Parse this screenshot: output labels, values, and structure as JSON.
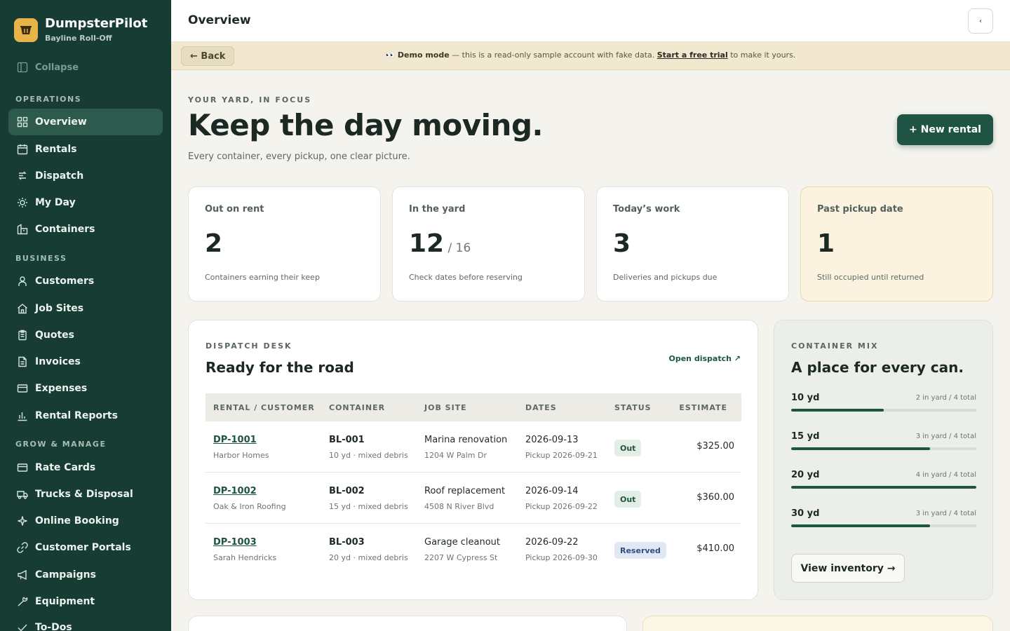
{
  "brand": {
    "name": "DumpsterPilot",
    "sub": "Bayline Roll-Off",
    "collapse": "Collapse"
  },
  "sidebar": {
    "sections": [
      "OPERATIONS",
      "BUSINESS",
      "GROW & MANAGE"
    ],
    "operations": [
      "Overview",
      "Rentals",
      "Dispatch",
      "My Day",
      "Containers"
    ],
    "business": [
      "Customers",
      "Job Sites",
      "Quotes",
      "Invoices",
      "Expenses",
      "Rental Reports"
    ],
    "grow": [
      "Rate Cards",
      "Trucks & Disposal",
      "Online Booking",
      "Customer Portals",
      "Campaigns",
      "Equipment",
      "To-Dos"
    ]
  },
  "topbar": {
    "title": "Overview",
    "toggle_icon": "chevron-left-icon"
  },
  "banner": {
    "back": "← Back",
    "emoji": "👀",
    "label": "Demo mode",
    "text": " — this is a read-only sample account with fake data. ",
    "link": "Start a free trial",
    "suffix": " to make it yours."
  },
  "hero": {
    "eyebrow": "YOUR YARD, IN FOCUS",
    "title": "Keep the day moving.",
    "subtitle": "Every container, every pickup, one clear picture.",
    "new_rental": "+  New rental"
  },
  "stats": [
    {
      "label": "Out on rent",
      "value": "2",
      "of": "",
      "note": "Containers earning their keep"
    },
    {
      "label": "In the yard",
      "value": "12",
      "of": " / 16",
      "note": "Check dates before reserving"
    },
    {
      "label": "Today’s work",
      "value": "3",
      "of": "",
      "note": "Deliveries and pickups due"
    },
    {
      "label": "Past pickup date",
      "value": "1",
      "of": "",
      "note": "Still occupied until returned"
    }
  ],
  "dispatch": {
    "eyebrow": "DISPATCH DESK",
    "title": "Ready for the road",
    "open_link": "Open dispatch ↗",
    "columns": [
      "RENTAL / CUSTOMER",
      "CONTAINER",
      "JOB SITE",
      "DATES",
      "STATUS",
      "ESTIMATE"
    ],
    "rows": [
      {
        "id": "DP-1001",
        "customer": "Harbor Homes",
        "container": "BL-001",
        "container_sub": "10 yd · mixed debris",
        "site": "Marina renovation",
        "address": "1204 W Palm Dr",
        "date": "2026-09-13",
        "pickup": "Pickup 2026-09-21",
        "status": "Out",
        "estimate": "$325.00"
      },
      {
        "id": "DP-1002",
        "customer": "Oak & Iron Roofing",
        "container": "BL-002",
        "container_sub": "15 yd · mixed debris",
        "site": "Roof replacement",
        "address": "4508 N River Blvd",
        "date": "2026-09-14",
        "pickup": "Pickup 2026-09-22",
        "status": "Out",
        "estimate": "$360.00"
      },
      {
        "id": "DP-1003",
        "customer": "Sarah Hendricks",
        "container": "BL-003",
        "container_sub": "20 yd · mixed debris",
        "site": "Garage cleanout",
        "address": "2207 W Cypress St",
        "date": "2026-09-22",
        "pickup": "Pickup 2026-09-30",
        "status": "Reserved",
        "estimate": "$410.00"
      }
    ]
  },
  "mix": {
    "eyebrow": "CONTAINER MIX",
    "title": "A place for every can.",
    "rows": [
      {
        "size": "10 yd",
        "count": "2 in yard / 4 total",
        "fraction": 0.5
      },
      {
        "size": "15 yd",
        "count": "3 in yard / 4 total",
        "fraction": 0.75
      },
      {
        "size": "20 yd",
        "count": "4 in yard / 4 total",
        "fraction": 1.0
      },
      {
        "size": "30 yd",
        "count": "3 in yard / 4 total",
        "fraction": 0.75
      }
    ],
    "view_inventory": "View inventory →"
  },
  "colors": {
    "sidebar": "#173c33",
    "accent": "#1f5444",
    "brand_logo": "#e8b44a",
    "warning_card": "#fbf3df"
  }
}
